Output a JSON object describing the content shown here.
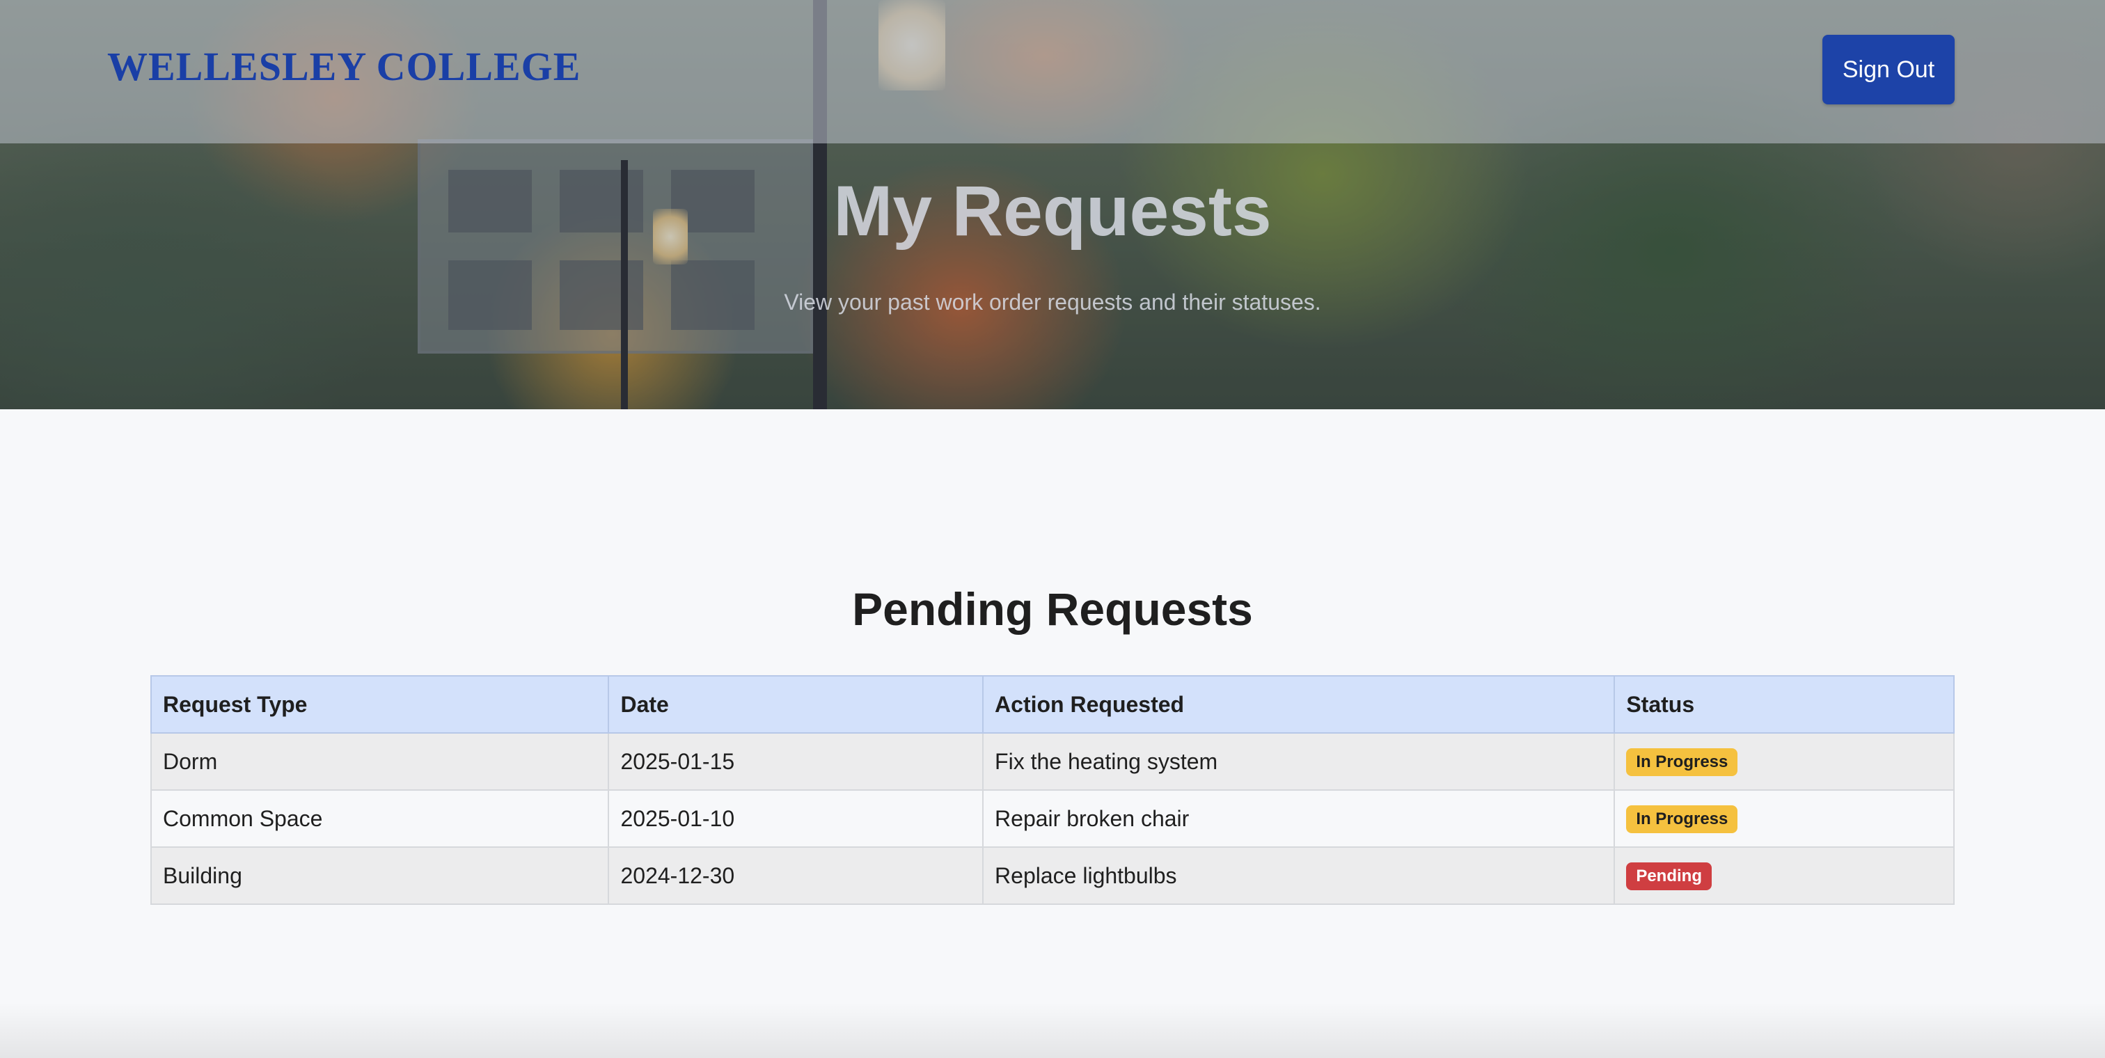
{
  "header": {
    "brand": "WELLESLEY COLLEGE",
    "sign_out_label": "Sign Out"
  },
  "hero": {
    "title": "My Requests",
    "subtitle": "View your past work order requests and their statuses."
  },
  "pending": {
    "title": "Pending Requests",
    "columns": [
      "Request Type",
      "Date",
      "Action Requested",
      "Status"
    ],
    "rows": [
      {
        "type": "Dorm",
        "date": "2025-01-15",
        "action": "Fix the heating system",
        "status": "In Progress"
      },
      {
        "type": "Common Space",
        "date": "2025-01-10",
        "action": "Repair broken chair",
        "status": "In Progress"
      },
      {
        "type": "Building",
        "date": "2024-12-30",
        "action": "Replace lightbulbs",
        "status": "Pending"
      }
    ]
  },
  "colors": {
    "brand": "#1a3fa6",
    "button": "#1d43a8",
    "header_row": "#d3e1fb",
    "status_in_progress": "#f5c13f",
    "status_pending": "#cf3e41"
  }
}
